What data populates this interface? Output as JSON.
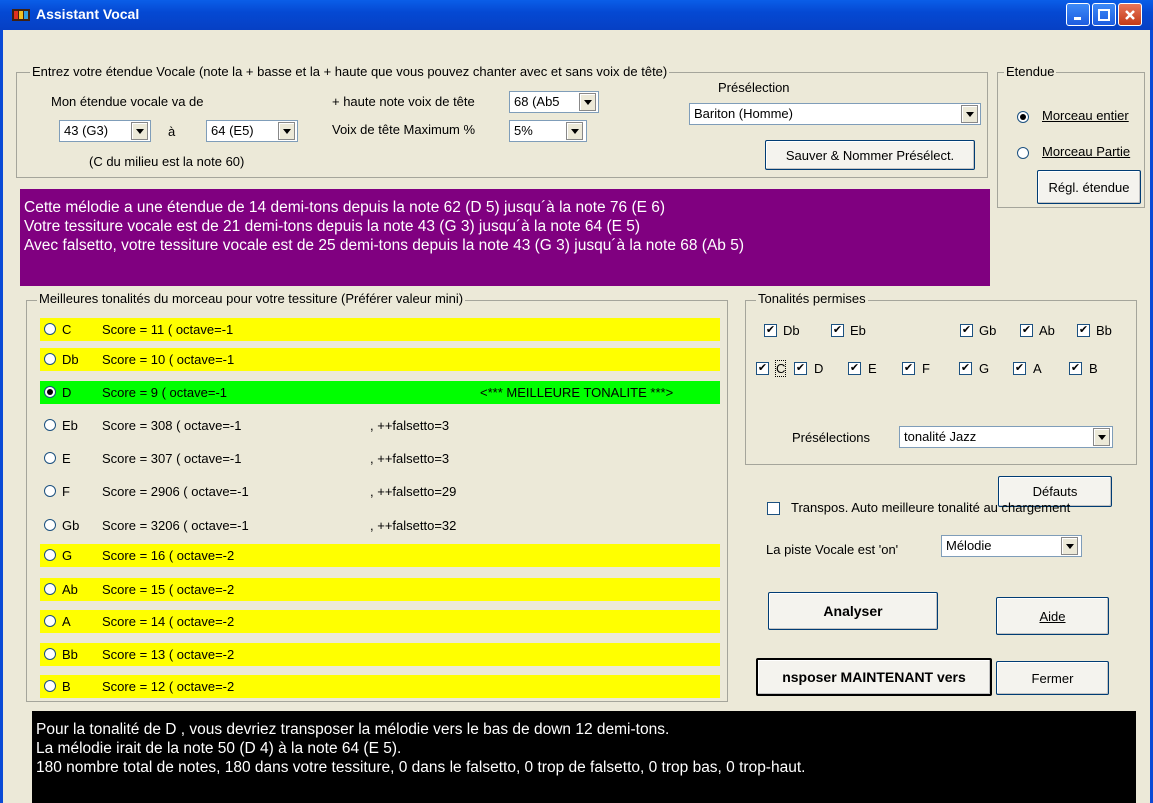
{
  "window": {
    "title": "Assistant Vocal"
  },
  "range_group": {
    "legend": "Entrez votre étendue Vocale (note la + basse et la + haute que vous pouvez chanter avec et sans voix de tête)",
    "range_label": "Mon étendue vocale va de",
    "low_value": "43 (G3)",
    "to_label": "à",
    "high_value": "64 (E5)",
    "middle_c_note": "(C du milieu est la note 60)",
    "head_voice_label": "+ haute note voix de tête",
    "head_voice_value": "68 (Ab5",
    "head_max_label": "Voix de tête Maximum %",
    "head_max_value": "5%",
    "preset_label": "Présélection",
    "preset_value": "Bariton (Homme)",
    "save_button": "Sauver & Nommer Présélect."
  },
  "etendue_group": {
    "legend": "Etendue",
    "whole_song": "Morceau entier",
    "partial_song": "Morceau Partie",
    "settings_button": "Régl. étendue"
  },
  "info_panel": {
    "line1": "Cette mélodie a une étendue de 14 demi-tons depuis la note 62 (D  5)  jusqu´à la note 76 (E  6)",
    "line2": "Votre tessiture vocale est de 21 demi-tons depuis la note 43 (G  3)  jusqu´à la note 64 (E  5)",
    "line3": "Avec falsetto, votre tessiture vocale est de 25 demi-tons depuis la note 43 (G  3)  jusqu´à la note 68 (Ab 5)"
  },
  "keys_group": {
    "legend": "Meilleures tonalités du morceau pour votre tessiture (Préférer valeur mini)",
    "rows": [
      {
        "key": "C",
        "score": "Score =   11  (  octave=-1",
        "extra": "",
        "color": "#ffff00",
        "selected": false
      },
      {
        "key": "Db",
        "score": "Score =   10  (  octave=-1",
        "extra": "",
        "color": "#ffff00",
        "selected": false
      },
      {
        "key": "D",
        "score": "Score =   9  (  octave=-1",
        "extra": "<*** MEILLEURE TONALITE   ***>",
        "color": "#00ff00",
        "selected": true
      },
      {
        "key": "Eb",
        "score": "Score =   308  (  octave=-1",
        "extra": ",  ++falsetto=3",
        "color": "",
        "selected": false
      },
      {
        "key": "E",
        "score": "Score =   307  (  octave=-1",
        "extra": ",  ++falsetto=3",
        "color": "",
        "selected": false
      },
      {
        "key": "F",
        "score": "Score =   2906  (  octave=-1",
        "extra": ",  ++falsetto=29",
        "color": "",
        "selected": false
      },
      {
        "key": "Gb",
        "score": "Score =   3206  (  octave=-1",
        "extra": ",  ++falsetto=32",
        "color": "",
        "selected": false
      },
      {
        "key": "G",
        "score": "Score =   16  (  octave=-2",
        "extra": "",
        "color": "#ffff00",
        "selected": false
      },
      {
        "key": "Ab",
        "score": "Score =   15  (  octave=-2",
        "extra": "",
        "color": "#ffff00",
        "selected": false
      },
      {
        "key": "A",
        "score": "Score =   14  (  octave=-2",
        "extra": "",
        "color": "#ffff00",
        "selected": false
      },
      {
        "key": "Bb",
        "score": "Score =   13  (  octave=-2",
        "extra": "",
        "color": "#ffff00",
        "selected": false
      },
      {
        "key": "B",
        "score": "Score =   12  (  octave=-2",
        "extra": "",
        "color": "#ffff00",
        "selected": false
      }
    ]
  },
  "allowed_keys": {
    "legend": "Tonalités permises",
    "row1": [
      "Db",
      "Eb",
      "Gb",
      "Ab",
      "Bb"
    ],
    "row2": [
      "C",
      "D",
      "E",
      "F",
      "G",
      "A",
      "B"
    ],
    "presets_label": "Présélections",
    "presets_value": "tonalité Jazz"
  },
  "controls": {
    "defaults_button": "Défauts",
    "auto_transpose": "Transpos. Auto meilleure tonalité au chargement",
    "vocal_track_label": "La piste Vocale est 'on'",
    "vocal_track_value": "Mélodie",
    "analyze_button": "Analyser",
    "help_button": "Aide",
    "transpose_button": "nsposer MAINTENANT vers",
    "close_button": "Fermer"
  },
  "result_panel": {
    "line1": "Pour la tonalité de D  , vous devriez transposer la mélodie  vers le bas de down 12 demi-tons.",
    "line2": "La mélodie irait de la note 50 (D  4) à la note 64 (E  5).",
    "line3": "180 nombre total de notes, 180 dans votre tessiture, 0 dans le falsetto, 0 trop de falsetto, 0 trop bas, 0 trop-haut."
  }
}
